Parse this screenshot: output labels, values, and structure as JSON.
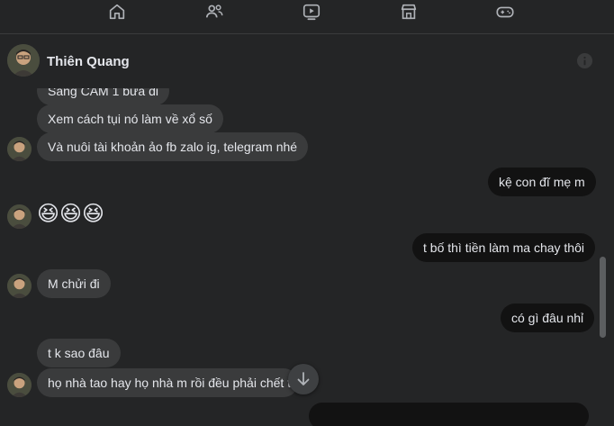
{
  "header": {
    "contact_name": "Thiên Quang"
  },
  "nav": {
    "icons": [
      "home-icon",
      "friends-icon",
      "watch-icon",
      "marketplace-icon",
      "gaming-icon"
    ]
  },
  "messages": [
    {
      "side": "in",
      "text": "Sang CAM 1 bữa đi"
    },
    {
      "side": "in",
      "text": "Xem cách tụi nó làm về xổ số"
    },
    {
      "side": "in",
      "text": "Và nuôi tài khoản ảo fb zalo ig, telegram nhé"
    },
    {
      "side": "out",
      "text": "kệ con đĩ mẹ m"
    },
    {
      "side": "in",
      "text": "😆😆😆",
      "emoji": "laughing-emoji"
    },
    {
      "side": "out",
      "text": "t bố thì tiền làm ma chay thôi"
    },
    {
      "side": "in",
      "text": "M chửi đi"
    },
    {
      "side": "out",
      "text": "có gì đâu nhỉ"
    },
    {
      "side": "in",
      "text": "t k sao đâu"
    },
    {
      "side": "in",
      "text": "họ nhà tao hay họ nhà m rồi đều phải chết th"
    }
  ],
  "colors": {
    "background": "#242526",
    "incoming_bubble": "#3a3b3c",
    "outgoing_bubble": "#121212",
    "text": "#e4e6eb"
  }
}
